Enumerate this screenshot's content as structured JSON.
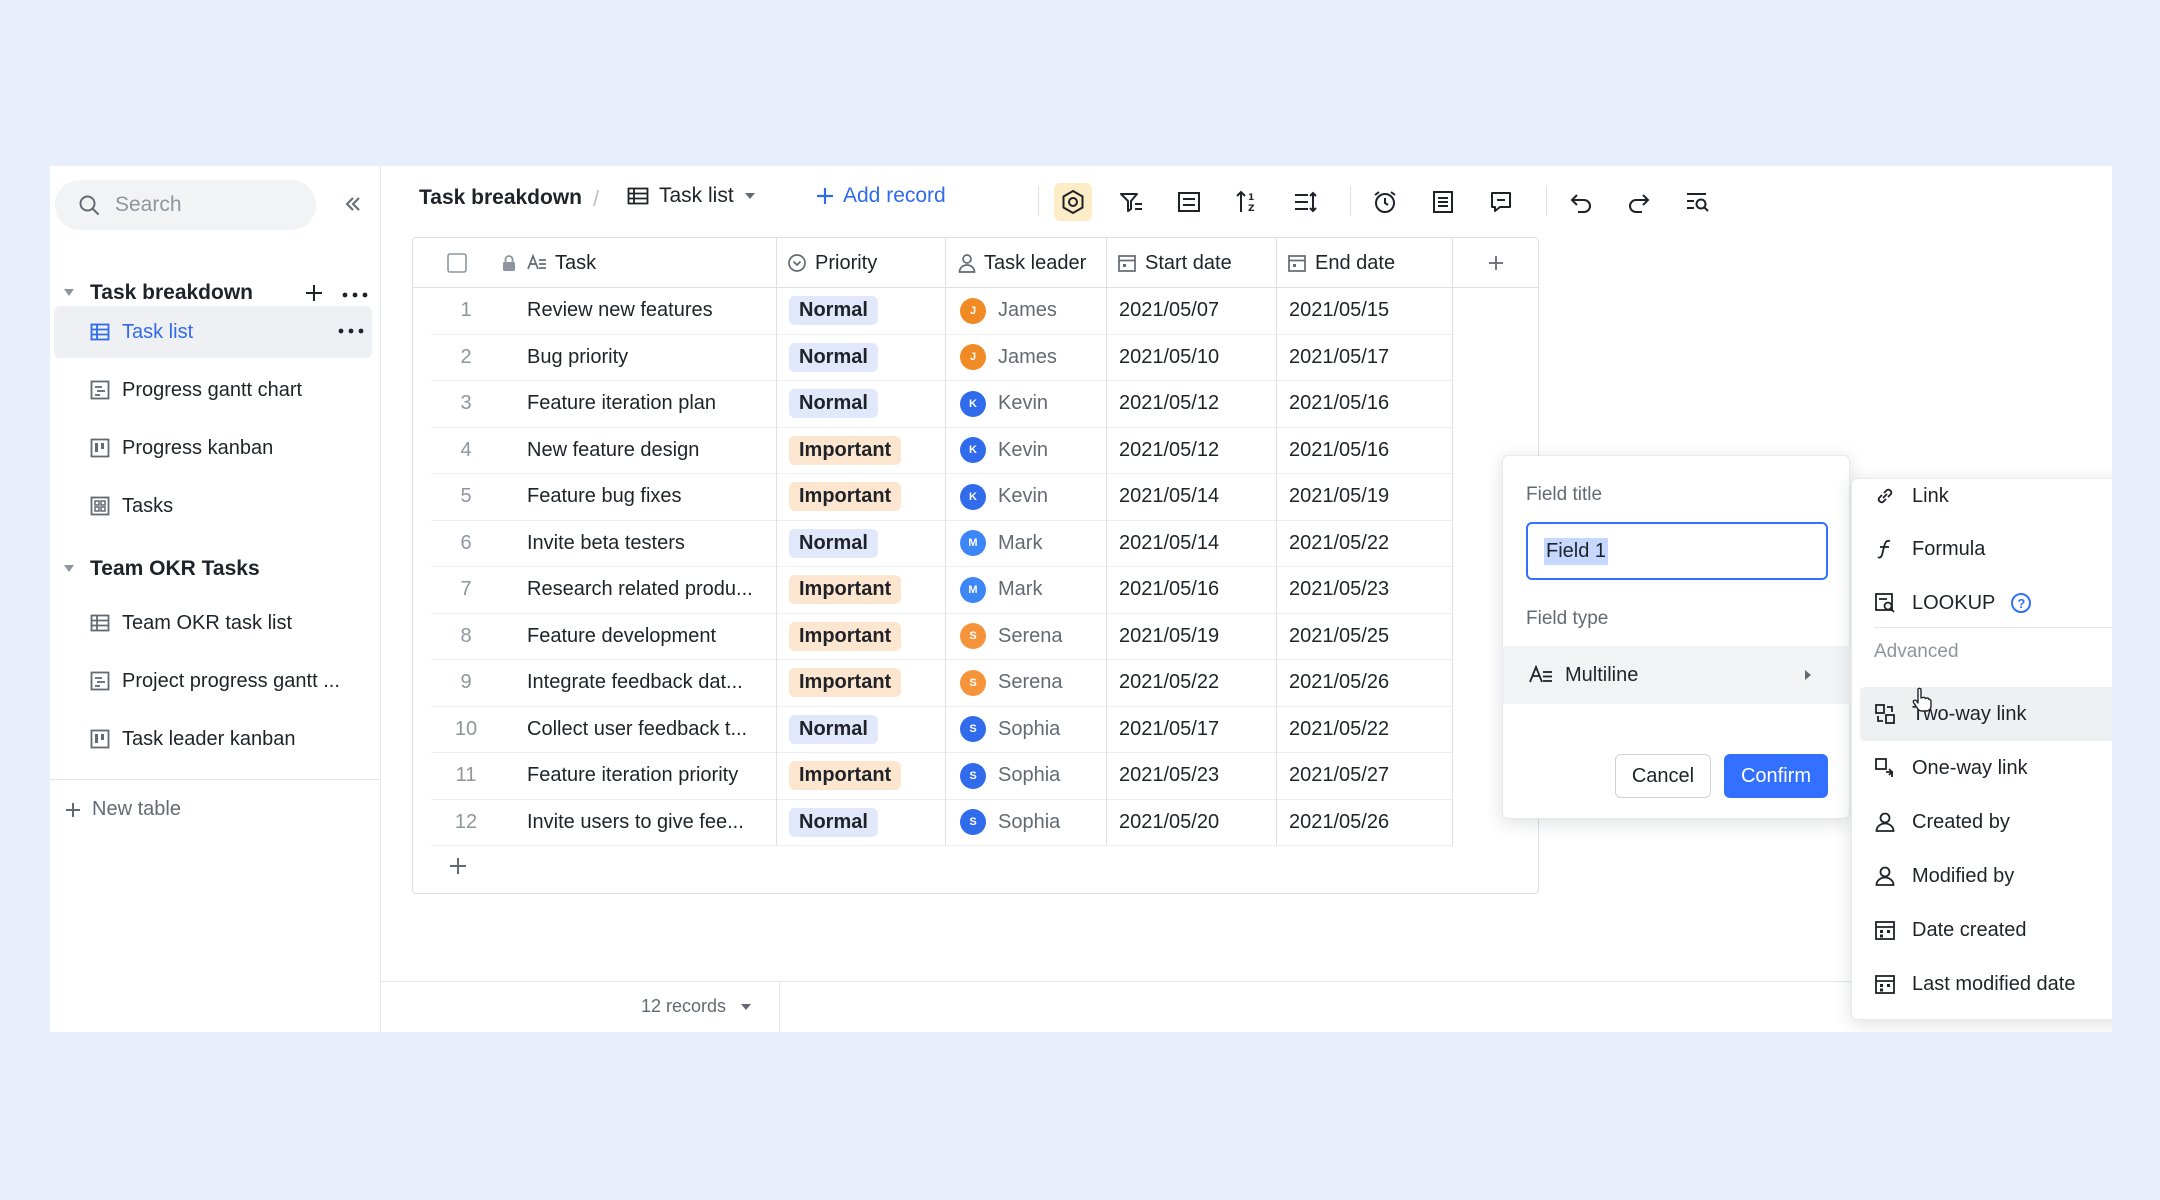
{
  "sidebar": {
    "search_placeholder": "Search",
    "groups": [
      {
        "title": "Task breakdown",
        "items": [
          {
            "label": "Task list",
            "icon": "grid-view-icon",
            "active": true
          },
          {
            "label": "Progress gantt chart",
            "icon": "gantt-view-icon"
          },
          {
            "label": "Progress kanban",
            "icon": "kanban-view-icon"
          },
          {
            "label": "Tasks",
            "icon": "form-view-icon"
          }
        ]
      },
      {
        "title": "Team OKR Tasks",
        "items": [
          {
            "label": "Team OKR task list",
            "icon": "grid-view-icon"
          },
          {
            "label": "Project progress gantt ...",
            "icon": "gantt-view-icon"
          },
          {
            "label": "Task leader kanban",
            "icon": "kanban-view-icon"
          }
        ]
      }
    ],
    "new_table": "New table"
  },
  "toolbar": {
    "breadcrumb": "Task breakdown",
    "separator": "/",
    "view": "Task list",
    "add_record": "Add record",
    "accent": "#2f6bea"
  },
  "grid": {
    "columns": [
      "Task",
      "Priority",
      "Task leader",
      "Start date",
      "End date"
    ],
    "rows": [
      {
        "n": "1",
        "task": "Review new features",
        "priority": "Normal",
        "leader": "James",
        "initial": "J",
        "color": "#f08a24",
        "start": "2021/05/07",
        "end": "2021/05/15"
      },
      {
        "n": "2",
        "task": "Bug priority",
        "priority": "Normal",
        "leader": "James",
        "initial": "J",
        "color": "#f08a24",
        "start": "2021/05/10",
        "end": "2021/05/17"
      },
      {
        "n": "3",
        "task": "Feature iteration plan",
        "priority": "Normal",
        "leader": "Kevin",
        "initial": "K",
        "color": "#2f6bea",
        "start": "2021/05/12",
        "end": "2021/05/16"
      },
      {
        "n": "4",
        "task": "New feature design",
        "priority": "Important",
        "leader": "Kevin",
        "initial": "K",
        "color": "#2f6bea",
        "start": "2021/05/12",
        "end": "2021/05/16"
      },
      {
        "n": "5",
        "task": "Feature bug fixes",
        "priority": "Important",
        "leader": "Kevin",
        "initial": "K",
        "color": "#2f6bea",
        "start": "2021/05/14",
        "end": "2021/05/19"
      },
      {
        "n": "6",
        "task": "Invite beta testers",
        "priority": "Normal",
        "leader": "Mark",
        "initial": "M",
        "color": "#3d86f5",
        "start": "2021/05/14",
        "end": "2021/05/22"
      },
      {
        "n": "7",
        "task": "Research related produ...",
        "priority": "Important",
        "leader": "Mark",
        "initial": "M",
        "color": "#3d86f5",
        "start": "2021/05/16",
        "end": "2021/05/23"
      },
      {
        "n": "8",
        "task": "Feature development",
        "priority": "Important",
        "leader": "Serena",
        "initial": "S",
        "color": "#f5943a",
        "start": "2021/05/19",
        "end": "2021/05/25"
      },
      {
        "n": "9",
        "task": "Integrate feedback dat...",
        "priority": "Important",
        "leader": "Serena",
        "initial": "S",
        "color": "#f5943a",
        "start": "2021/05/22",
        "end": "2021/05/26"
      },
      {
        "n": "10",
        "task": "Collect user feedback t...",
        "priority": "Normal",
        "leader": "Sophia",
        "initial": "S",
        "color": "#2f6bea",
        "start": "2021/05/17",
        "end": "2021/05/22"
      },
      {
        "n": "11",
        "task": "Feature iteration priority",
        "priority": "Important",
        "leader": "Sophia",
        "initial": "S",
        "color": "#2f6bea",
        "start": "2021/05/23",
        "end": "2021/05/27"
      },
      {
        "n": "12",
        "task": "Invite users to give fee...",
        "priority": "Normal",
        "leader": "Sophia",
        "initial": "S",
        "color": "#2f6bea",
        "start": "2021/05/20",
        "end": "2021/05/26"
      }
    ]
  },
  "footer": {
    "records": "12 records"
  },
  "field_popup": {
    "title_label": "Field title",
    "title_value": "Field 1",
    "type_label": "Field type",
    "type_value": "Multiline",
    "cancel": "Cancel",
    "confirm": "Confirm"
  },
  "type_menu": {
    "items_top": [
      "Link",
      "Formula",
      "LOOKUP"
    ],
    "section": "Advanced",
    "items_advanced": [
      "Two-way link",
      "One-way link",
      "Created by",
      "Modified by",
      "Date created",
      "Last modified date"
    ]
  }
}
